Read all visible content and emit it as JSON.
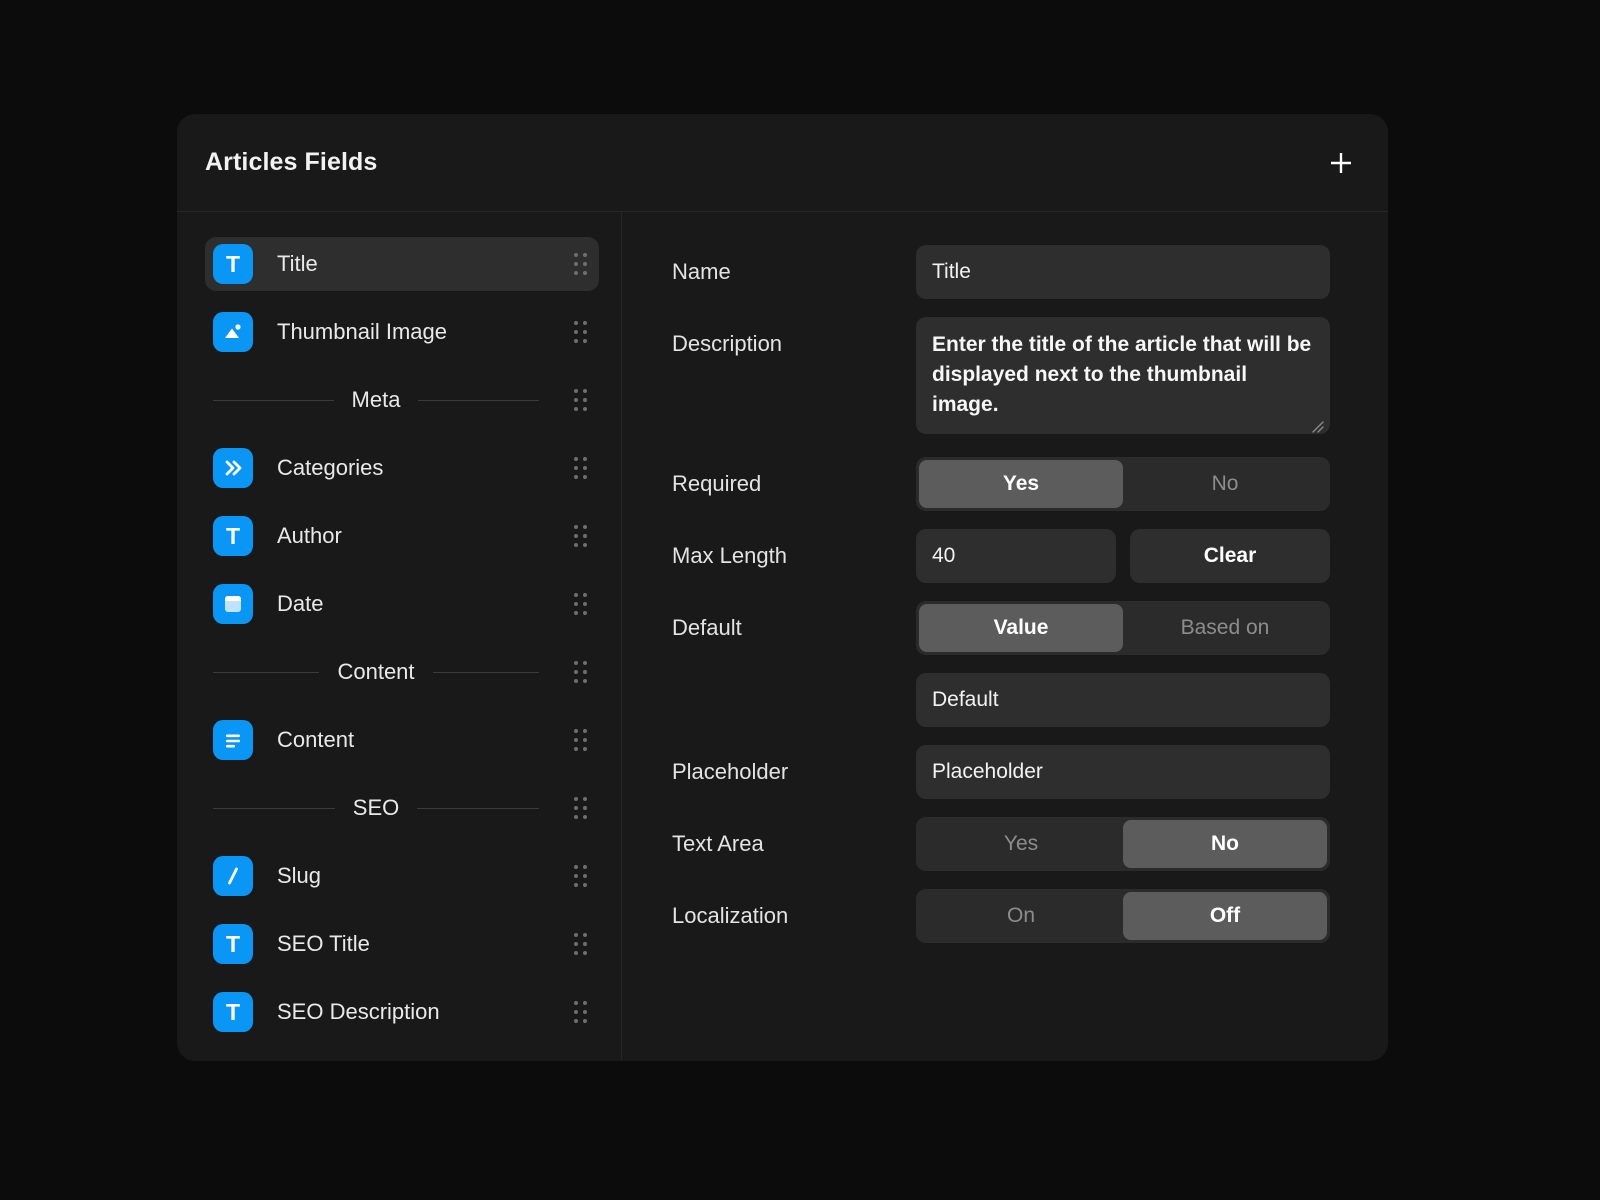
{
  "header": {
    "title": "Articles Fields",
    "add_button_label": "+",
    "add_icon": "plus-icon"
  },
  "sidebar": {
    "items": [
      {
        "type": "field",
        "label": "Title",
        "icon": "text-icon",
        "glyph": "T",
        "selected": true
      },
      {
        "type": "field",
        "label": "Thumbnail Image",
        "icon": "image-icon",
        "selected": false
      },
      {
        "type": "group",
        "label": "Meta"
      },
      {
        "type": "field",
        "label": "Categories",
        "icon": "double-chevron-icon",
        "selected": false
      },
      {
        "type": "field",
        "label": "Author",
        "icon": "text-icon",
        "glyph": "T",
        "selected": false
      },
      {
        "type": "field",
        "label": "Date",
        "icon": "calendar-icon",
        "selected": false
      },
      {
        "type": "group",
        "label": "Content"
      },
      {
        "type": "field",
        "label": "Content",
        "icon": "paragraph-icon",
        "selected": false
      },
      {
        "type": "group",
        "label": "SEO"
      },
      {
        "type": "field",
        "label": "Slug",
        "icon": "slash-icon",
        "glyph": "/",
        "selected": false
      },
      {
        "type": "field",
        "label": "SEO Title",
        "icon": "text-icon",
        "glyph": "T",
        "selected": false
      },
      {
        "type": "field",
        "label": "SEO Description",
        "icon": "text-icon",
        "glyph": "T",
        "selected": false
      }
    ],
    "drag_handle_icon": "drag-dots-icon"
  },
  "detail": {
    "name": {
      "label": "Name",
      "value": "Title"
    },
    "description": {
      "label": "Description",
      "value": "Enter the title of the article that will be displayed next to the thumbnail image.",
      "resize_icon": "resize-grip-icon"
    },
    "required": {
      "label": "Required",
      "options": [
        "Yes",
        "No"
      ],
      "selected": "Yes"
    },
    "max_length": {
      "label": "Max Length",
      "value": "40",
      "clear_label": "Clear"
    },
    "default": {
      "label": "Default",
      "options": [
        "Value",
        "Based on"
      ],
      "selected": "Value",
      "value_placeholder": "Default"
    },
    "placeholder": {
      "label": "Placeholder",
      "value_placeholder": "Placeholder"
    },
    "text_area": {
      "label": "Text Area",
      "options": [
        "Yes",
        "No"
      ],
      "selected": "No"
    },
    "localization": {
      "label": "Localization",
      "options": [
        "On",
        "Off"
      ],
      "selected": "Off"
    }
  },
  "colors": {
    "page_background": "#0c0c0c",
    "card_background": "#191919",
    "accent": "#0a96f5",
    "input_background": "#2e2e2e",
    "segment_active": "#5c5c5c"
  }
}
